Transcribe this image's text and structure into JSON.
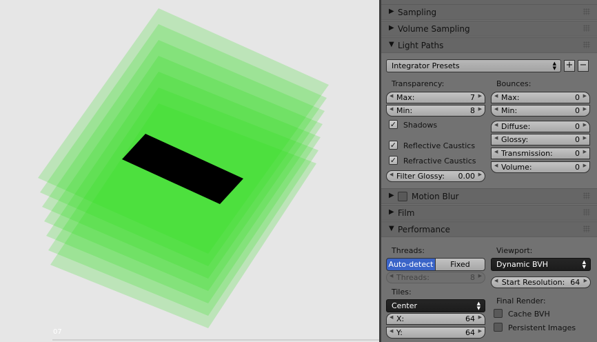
{
  "viewport": {
    "frame_label": "07"
  },
  "colors": {
    "accent": "#3a64c8",
    "plane_green": "#2fe01a",
    "panel_bg": "#727272"
  },
  "panels": {
    "sampling": "Sampling",
    "volume_sampling": "Volume Sampling",
    "light_paths": "Light Paths",
    "motion_blur": "Motion Blur",
    "film": "Film",
    "performance": "Performance"
  },
  "light_paths": {
    "integrator_presets": "Integrator Presets",
    "transparency_label": "Transparency:",
    "bounces_label": "Bounces:",
    "transparency": {
      "max": {
        "name": "Max:",
        "value": "7"
      },
      "min": {
        "name": "Min:",
        "value": "8"
      }
    },
    "bounces": {
      "max": {
        "name": "Max:",
        "value": "0"
      },
      "min": {
        "name": "Min:",
        "value": "0"
      },
      "diffuse": {
        "name": "Diffuse:",
        "value": "0"
      },
      "glossy": {
        "name": "Glossy:",
        "value": "0"
      },
      "transmission": {
        "name": "Transmission:",
        "value": "0"
      },
      "volume": {
        "name": "Volume:",
        "value": "0"
      }
    },
    "shadows": "Shadows",
    "reflective_caustics": "Reflective Caustics",
    "refractive_caustics": "Refractive Caustics",
    "filter_glossy": {
      "name": "Filter Glossy:",
      "value": "0.00"
    }
  },
  "performance": {
    "threads_label": "Threads:",
    "auto_detect": "Auto-detect",
    "fixed": "Fixed",
    "threads_field": {
      "name": "Threads:",
      "value": "8"
    },
    "tiles_label": "Tiles:",
    "tiles_order": "Center",
    "tile_x": {
      "name": "X:",
      "value": "64"
    },
    "tile_y": {
      "name": "Y:",
      "value": "64"
    },
    "viewport_label": "Viewport:",
    "viewport_bvh": "Dynamic BVH",
    "start_resolution": {
      "name": "Start Resolution:",
      "value": "64"
    },
    "final_render_label": "Final Render:",
    "cache_bvh": "Cache BVH",
    "persistent_images": "Persistent Images"
  }
}
